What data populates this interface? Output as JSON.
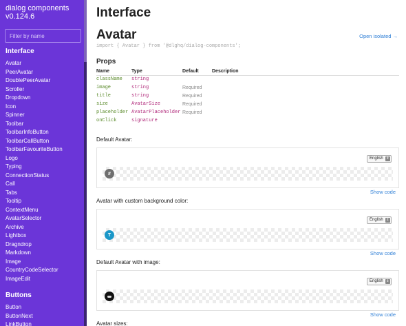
{
  "sidebar": {
    "title_line1": "dialog components",
    "title_line2": "v0.124.6",
    "filter_placeholder": "Filter by name",
    "interface_title": "Interface",
    "interface_items": [
      "Avatar",
      "PeerAvatar",
      "DoublePeerAvatar",
      "Scroller",
      "Dropdown",
      "Icon",
      "Spinner",
      "Toolbar",
      "ToolbarInfoButton",
      "ToolbarCallButton",
      "ToolbarFavouriteButton",
      "Logo",
      "Typing",
      "ConnectionStatus",
      "Call",
      "Tabs",
      "Tooltip",
      "ContextMenu",
      "AvatarSelector",
      "Archive",
      "Lightbox",
      "Dragndrop",
      "Markdown",
      "Image",
      "CountryCodeSelector",
      "ImageEdit"
    ],
    "buttons_title": "Buttons",
    "buttons_items": [
      "Button",
      "ButtonNext",
      "LinkButton"
    ]
  },
  "main": {
    "page_title": "Interface",
    "component_title": "Avatar",
    "open_isolated": "Open isolated →",
    "import_line": "import { Avatar } from '@dlghq/dialog-components';",
    "props_title": "Props",
    "props_headers": [
      "Name",
      "Type",
      "Default",
      "Description"
    ],
    "props": [
      {
        "name": "className",
        "type": "string",
        "default": "",
        "description": ""
      },
      {
        "name": "image",
        "type": "string",
        "default": "Required",
        "description": ""
      },
      {
        "name": "title",
        "type": "string",
        "default": "Required",
        "description": ""
      },
      {
        "name": "size",
        "type": "AvatarSize",
        "default": "Required",
        "description": ""
      },
      {
        "name": "placeholder",
        "type": "AvatarPlaceholder",
        "default": "Required",
        "description": ""
      },
      {
        "name": "onClick",
        "type": "signature",
        "default": "",
        "description": ""
      }
    ],
    "examples": [
      {
        "label": "Default Avatar:",
        "language": "English",
        "avatar_text": "#",
        "show_code": "Show code"
      },
      {
        "label": "Avatar with custom background color:",
        "language": "English",
        "avatar_text": "T",
        "show_code": "Show code"
      },
      {
        "label": "Default Avatar with image:",
        "language": "English",
        "avatar_text": "",
        "show_code": "Show code"
      }
    ],
    "next_section_label": "Avatar sizes:"
  },
  "colors": {
    "sidebar_bg": "#6b35d8",
    "link": "#2f7fd6",
    "prop_name": "#5a8a2a",
    "prop_type": "#b0287a",
    "avatar_teal": "#1b97c8",
    "avatar_gray": "#6e6e6e"
  }
}
